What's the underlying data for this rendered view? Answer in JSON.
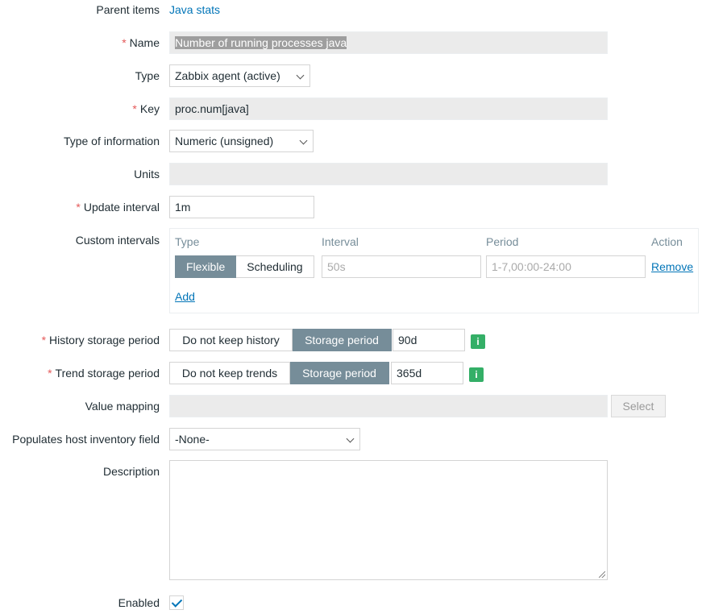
{
  "parent_items": {
    "label": "Parent items",
    "value": "Java stats"
  },
  "name": {
    "label": "Name",
    "value": "Number of running processes java"
  },
  "type": {
    "label": "Type",
    "value": "Zabbix agent (active)"
  },
  "key": {
    "label": "Key",
    "value": "proc.num[java]"
  },
  "type_of_information": {
    "label": "Type of information",
    "value": "Numeric (unsigned)"
  },
  "units": {
    "label": "Units",
    "value": ""
  },
  "update_interval": {
    "label": "Update interval",
    "value": "1m"
  },
  "custom_intervals": {
    "label": "Custom intervals",
    "headers": {
      "type": "Type",
      "interval": "Interval",
      "period": "Period",
      "action": "Action"
    },
    "row": {
      "flexible": "Flexible",
      "scheduling": "Scheduling",
      "interval_placeholder": "50s",
      "period_placeholder": "1-7,00:00-24:00",
      "remove": "Remove"
    },
    "add": "Add"
  },
  "history_storage": {
    "label": "History storage period",
    "off": "Do not keep history",
    "on": "Storage period",
    "value": "90d"
  },
  "trend_storage": {
    "label": "Trend storage period",
    "off": "Do not keep trends",
    "on": "Storage period",
    "value": "365d"
  },
  "value_mapping": {
    "label": "Value mapping",
    "value": "",
    "select": "Select"
  },
  "inventory_field": {
    "label": "Populates host inventory field",
    "value": "-None-"
  },
  "description": {
    "label": "Description",
    "value": ""
  },
  "enabled": {
    "label": "Enabled",
    "checked": true
  },
  "colors": {
    "accent": "#0275b8",
    "required": "#e45959",
    "segment_active": "#768d99",
    "info": "#34af67"
  }
}
